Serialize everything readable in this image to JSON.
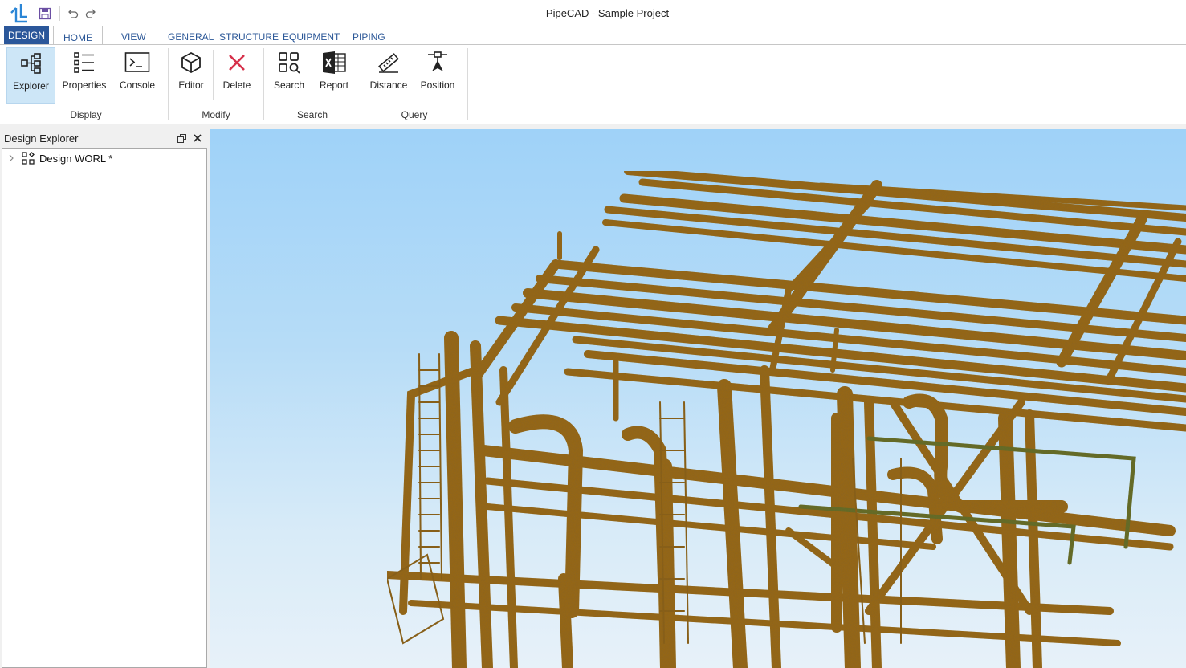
{
  "window": {
    "title": "PipeCAD - Sample Project"
  },
  "quick_access": {
    "save_icon": "save-icon",
    "undo_icon": "undo-icon",
    "redo_icon": "redo-icon"
  },
  "ribbon": {
    "app_tab": "DESIGN",
    "tabs": [
      "HOME",
      "VIEW",
      "GENERAL",
      "STRUCTURE",
      "EQUIPMENT",
      "PIPING"
    ],
    "active_tab": "HOME",
    "groups": {
      "display": {
        "label": "Display",
        "buttons": {
          "explorer": "Explorer",
          "properties": "Properties",
          "console": "Console"
        }
      },
      "modify": {
        "label": "Modify",
        "buttons": {
          "editor": "Editor",
          "delete": "Delete"
        }
      },
      "search": {
        "label": "Search",
        "buttons": {
          "search": "Search",
          "report": "Report"
        }
      },
      "query": {
        "label": "Query",
        "buttons": {
          "distance": "Distance",
          "position": "Position"
        }
      }
    }
  },
  "explorer": {
    "title": "Design Explorer",
    "tree": [
      {
        "label": "Design WORL *",
        "expanded": false
      }
    ]
  },
  "colors": {
    "accent": "#2b579a",
    "selected_button": "#cde6f7",
    "pipe": "#a8731a",
    "sky_top": "#9fd2f8",
    "sky_bottom": "#e7f1f9"
  }
}
